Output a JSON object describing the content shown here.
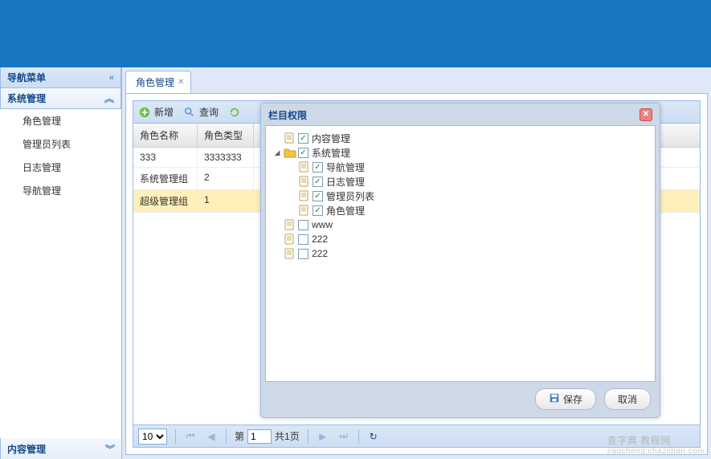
{
  "sidebar": {
    "nav_title": "导航菜单",
    "section_system": "系统管理",
    "section_content": "内容管理",
    "items": [
      {
        "label": "角色管理"
      },
      {
        "label": "管理员列表"
      },
      {
        "label": "日志管理"
      },
      {
        "label": "导航管理"
      }
    ]
  },
  "tabs": {
    "active": "角色管理"
  },
  "toolbar": {
    "add": "新增",
    "search": "查询"
  },
  "grid": {
    "headers": {
      "name": "角色名称",
      "type": "角色类型"
    },
    "rows": [
      {
        "name": "333",
        "type": "3333333"
      },
      {
        "name": "系统管理组",
        "type": "2"
      },
      {
        "name": "超级管理组",
        "type": "1"
      }
    ],
    "selected_index": 2
  },
  "paging": {
    "page_size_options": [
      "10"
    ],
    "page_size": "10",
    "prefix": "第",
    "current": "1",
    "total_text": "共1页"
  },
  "dialog": {
    "title": "栏目权限",
    "save": "保存",
    "cancel": "取消",
    "tree": [
      {
        "depth": 0,
        "expander": "none",
        "icon": "page",
        "checked": true,
        "label": "内容管理"
      },
      {
        "depth": 0,
        "expander": "open",
        "icon": "folder",
        "checked": true,
        "label": "系统管理"
      },
      {
        "depth": 1,
        "expander": "none",
        "icon": "page",
        "checked": true,
        "label": "导航管理"
      },
      {
        "depth": 1,
        "expander": "none",
        "icon": "page",
        "checked": true,
        "label": "日志管理"
      },
      {
        "depth": 1,
        "expander": "none",
        "icon": "page",
        "checked": true,
        "label": "管理员列表"
      },
      {
        "depth": 1,
        "expander": "none",
        "icon": "page",
        "checked": true,
        "label": "角色管理"
      },
      {
        "depth": 0,
        "expander": "none",
        "icon": "page",
        "checked": false,
        "label": "www"
      },
      {
        "depth": 0,
        "expander": "none",
        "icon": "page",
        "checked": false,
        "label": "222"
      },
      {
        "depth": 0,
        "expander": "none",
        "icon": "page",
        "checked": false,
        "label": "222"
      }
    ]
  },
  "watermark": {
    "main": "查字典 教程网",
    "sub": "jiaocheng.chazidian.com"
  }
}
